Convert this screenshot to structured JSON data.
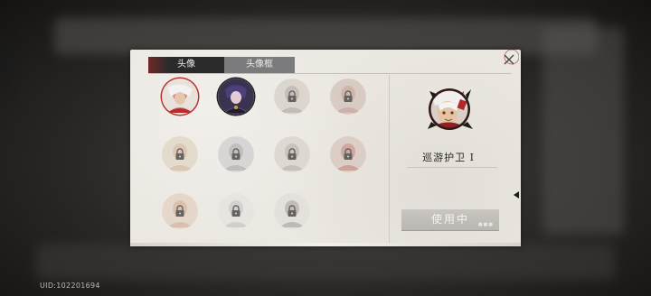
{
  "uid": "UID:102201694",
  "tabs": [
    {
      "label": "头像",
      "active": true
    },
    {
      "label": "头像框",
      "active": false
    }
  ],
  "avatars": [
    {
      "icon": "red-white-character-portrait",
      "locked": false,
      "state": "selected"
    },
    {
      "icon": "purple-haired-character-portrait",
      "locked": false,
      "state": "in-use"
    },
    {
      "icon": "character-portrait",
      "locked": true
    },
    {
      "icon": "character-portrait",
      "locked": true
    },
    {
      "icon": "character-portrait",
      "locked": true
    },
    {
      "icon": "character-portrait",
      "locked": true
    },
    {
      "icon": "character-portrait",
      "locked": true
    },
    {
      "icon": "character-portrait",
      "locked": true
    },
    {
      "icon": "character-portrait",
      "locked": true
    },
    {
      "icon": "character-portrait",
      "locked": true
    },
    {
      "icon": "character-portrait",
      "locked": true
    }
  ],
  "preview": {
    "name": "巡游护卫 I",
    "button_label": "使用中"
  },
  "colors": {
    "panel": "#ebe7e1",
    "tab_active": "#2b2a2a",
    "tab_inactive": "#7b7a7c",
    "accent_red": "#b8312b",
    "button_disabled": "#c3c0bb"
  }
}
